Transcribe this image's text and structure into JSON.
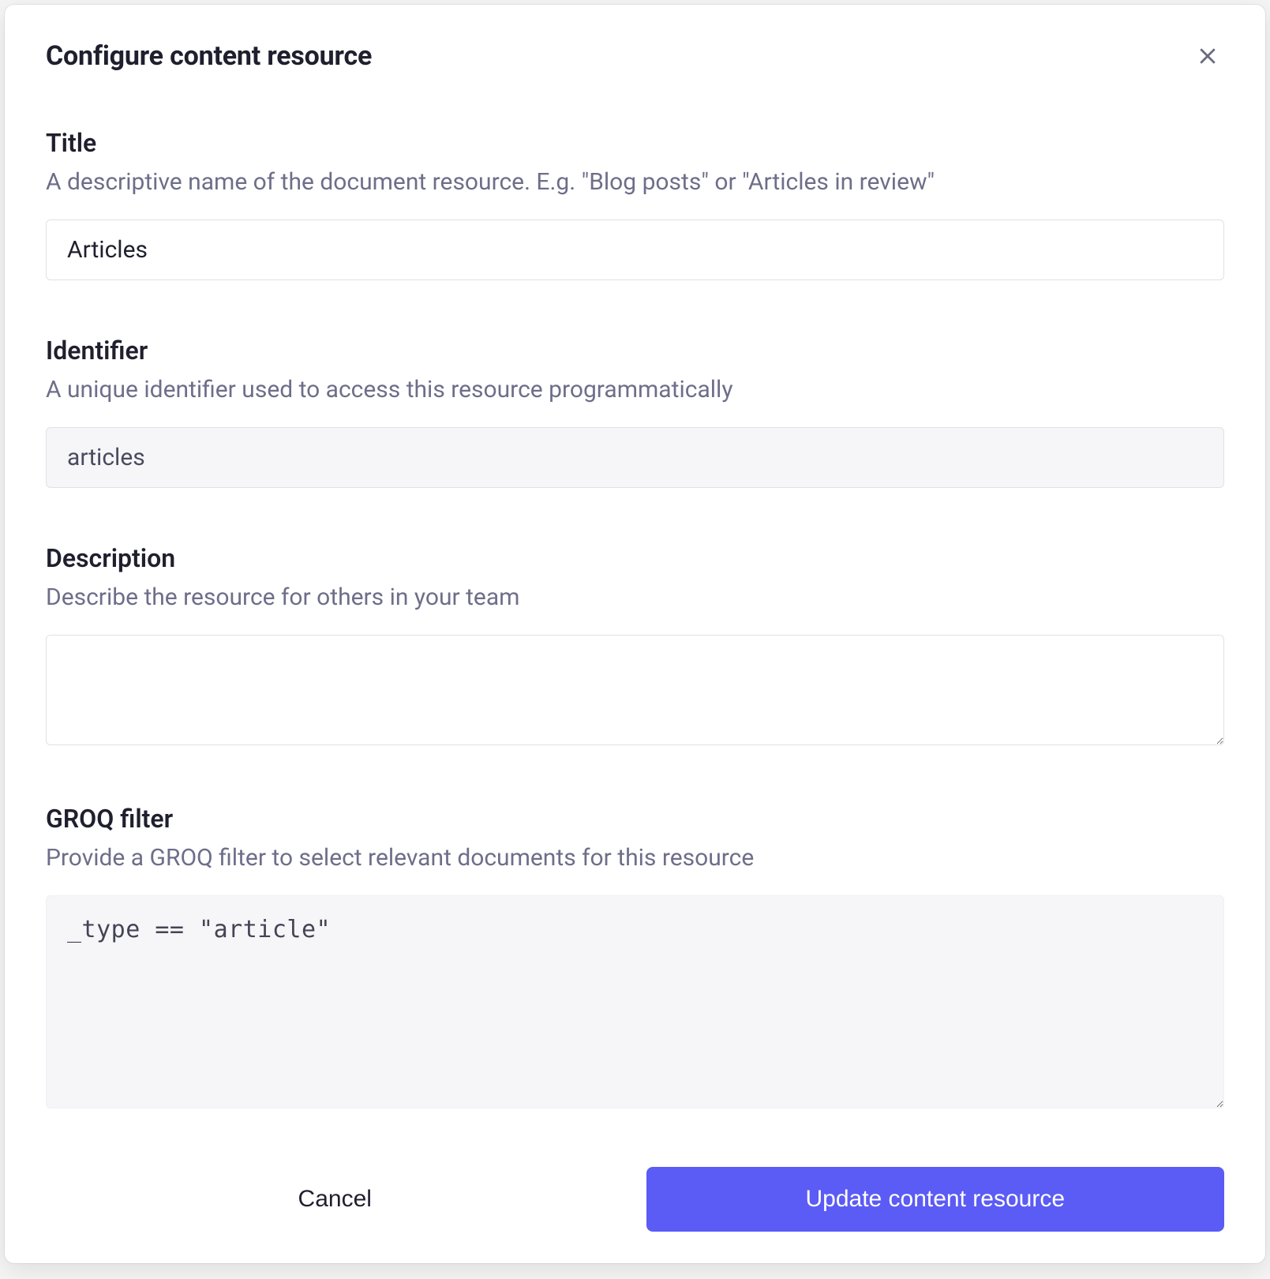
{
  "dialog": {
    "title": "Configure content resource",
    "fields": {
      "title": {
        "label": "Title",
        "help": "A descriptive name of the document resource. E.g. \"Blog posts\" or \"Articles in review\"",
        "value": "Articles"
      },
      "identifier": {
        "label": "Identifier",
        "help": "A unique identifier used to access this resource programmatically",
        "value": "articles"
      },
      "description": {
        "label": "Description",
        "help": "Describe the resource for others in your team",
        "value": ""
      },
      "groq_filter": {
        "label": "GROQ filter",
        "help": "Provide a GROQ filter to select relevant documents for this resource",
        "value": "_type == \"article\""
      }
    },
    "actions": {
      "cancel": "Cancel",
      "submit": "Update content resource"
    }
  }
}
